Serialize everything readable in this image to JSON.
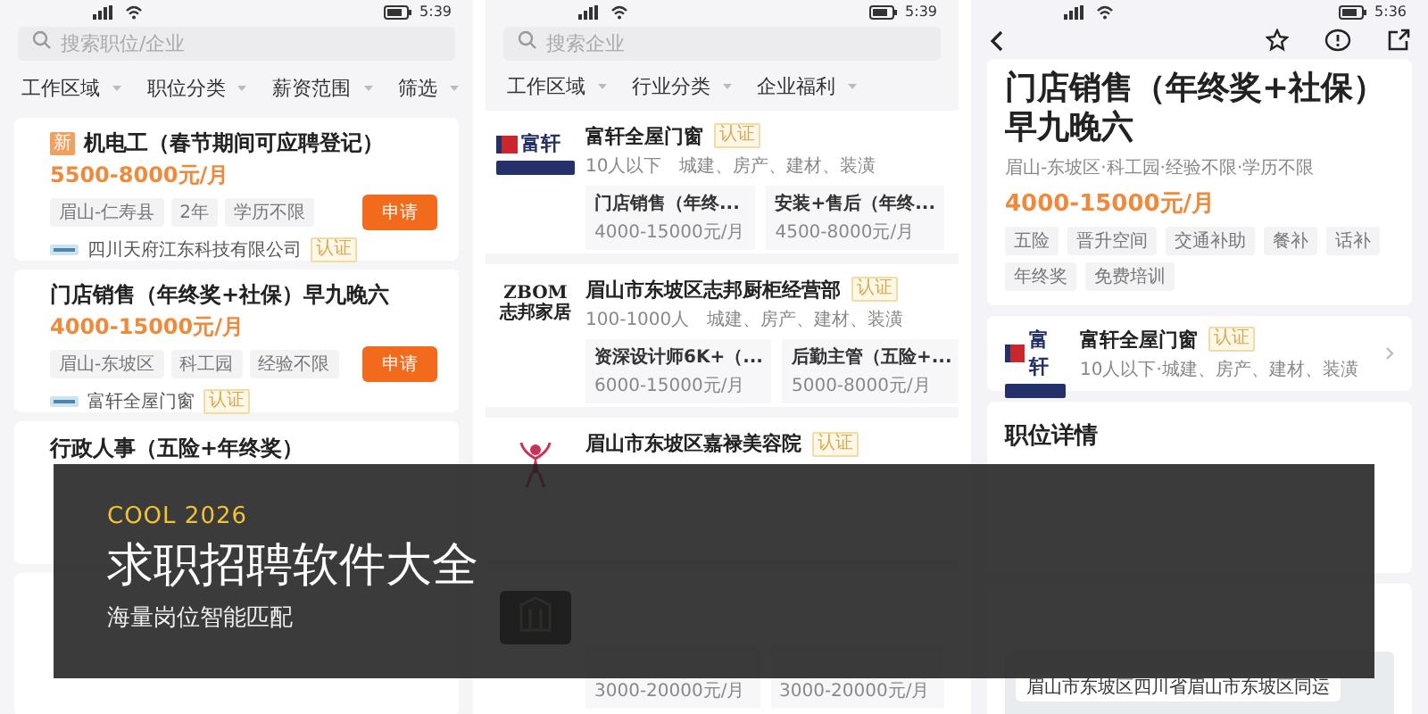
{
  "job_list_screen": {
    "status_bar": {
      "time": "5:39"
    },
    "search": {
      "placeholder": "搜索职位/企业"
    },
    "filters": [
      "工作区域",
      "职位分类",
      "薪资范围",
      "筛选"
    ],
    "jobs": [
      {
        "badge": "新",
        "title": "机电工（春节期间可应聘登记）",
        "salary": "5500-8000元/月",
        "tags": [
          "眉山-仁寿县",
          "2年",
          "学历不限"
        ],
        "apply": "申请",
        "company": "四川天府江东科技有限公司",
        "verified": "认证"
      },
      {
        "title": "门店销售（年终奖+社保）早九晚六",
        "salary": "4000-15000元/月",
        "tags": [
          "眉山-东坡区",
          "科工园",
          "经验不限"
        ],
        "apply": "申请",
        "company": "富轩全屋门窗",
        "verified": "认证"
      },
      {
        "title": "行政人事（五险+年终奖）"
      }
    ]
  },
  "company_list_screen": {
    "status_bar": {
      "time": "5:39"
    },
    "search": {
      "placeholder": "搜索企业"
    },
    "filters": [
      "工作区域",
      "行业分类",
      "企业福利"
    ],
    "companies": [
      {
        "logo": {
          "kind": "panel",
          "text": "富轩"
        },
        "name": "富轩全屋门窗",
        "verified": "认证",
        "size": "10人以下",
        "industry": "城建、房产、建材、装潢",
        "positions": [
          {
            "title": "门店销售（年终...",
            "salary": "4000-15000元/月"
          },
          {
            "title": "安装+售后（年终...",
            "salary": "4500-8000元/月"
          }
        ]
      },
      {
        "logo": {
          "kind": "wordmark",
          "text": "ZBOM\n志邦家居"
        },
        "name": "眉山市东坡区志邦厨柜经营部",
        "verified": "认证",
        "size": "100-1000人",
        "industry": "城建、房产、建材、装潢",
        "positions": [
          {
            "title": "资深设计师6K+（...",
            "salary": "6000-15000元/月"
          },
          {
            "title": "后勤主管（五险+...",
            "salary": "5000-8000元/月"
          }
        ]
      },
      {
        "logo": {
          "kind": "figure"
        },
        "name": "眉山市东坡区嘉禄美容院",
        "verified": "认证"
      },
      {
        "logo": {
          "kind": "dark"
        },
        "positions": [
          {
            "salary": "3000-20000元/月"
          },
          {
            "salary": "3000-20000元/月"
          }
        ]
      }
    ]
  },
  "job_detail_screen": {
    "status_bar": {
      "time": "5:36"
    },
    "title": "门店销售（年终奖+社保）早九晚六",
    "meta": "眉山-东坡区·科工园·经验不限·学历不限",
    "salary": "4000-15000元/月",
    "benefits": [
      "五险",
      "晋升空间",
      "交通补助",
      "餐补",
      "话补",
      "年终奖",
      "免费培训"
    ],
    "company": {
      "logo": {
        "kind": "panel",
        "text": "富轩"
      },
      "name": "富轩全屋门窗",
      "verified": "认证",
      "info": "10人以下·城建、房产、建材、装潢"
    },
    "details": {
      "heading": "职位详情"
    },
    "address": {
      "map_label": "眉山市东坡区四川省眉山市东坡区同运"
    }
  },
  "banner": {
    "kicker": "COOL 2026",
    "title": "求职招聘软件大全",
    "subtitle": "海量岗位智能匹配"
  }
}
